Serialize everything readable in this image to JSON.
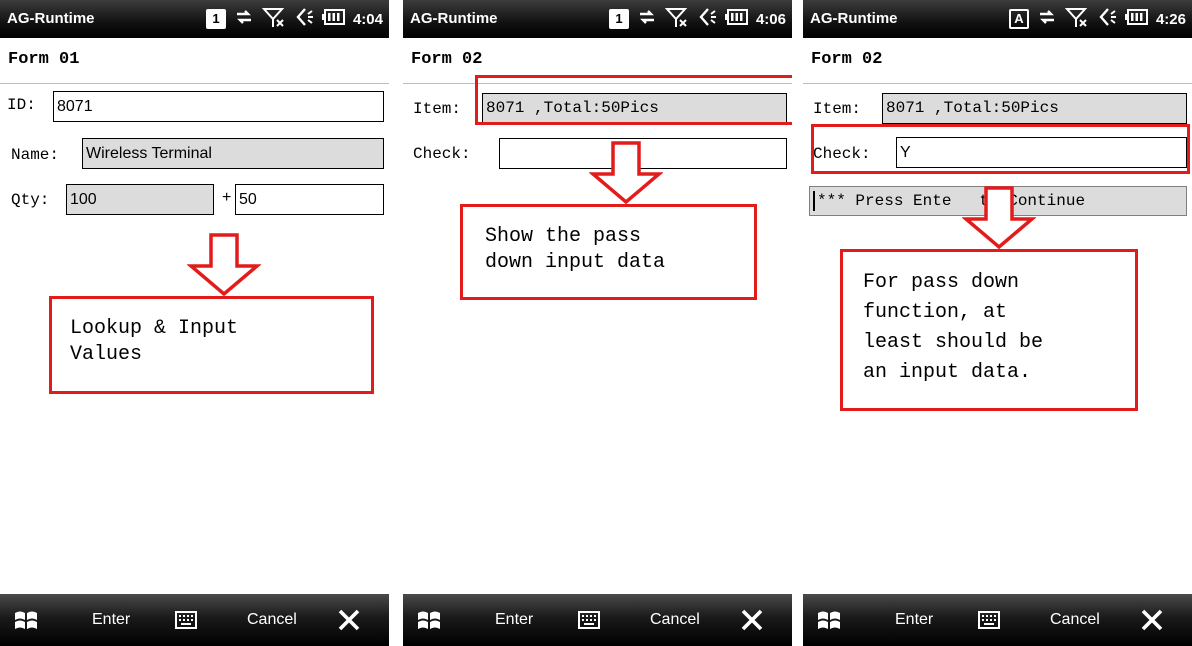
{
  "colors": {
    "callout_red": "#e21b1b",
    "readonly_bg": "#dcdcdc",
    "bar_bg": "#000000"
  },
  "screens": [
    {
      "app_title": "AG-Runtime",
      "input_mode": "1",
      "time": "4:04",
      "form_title": "Form 01",
      "fields": {
        "id": {
          "label": "ID:",
          "value": "8071"
        },
        "name": {
          "label": "Name:",
          "value": "Wireless Terminal"
        },
        "qty": {
          "label": "Qty:",
          "value": "100",
          "plus": "+",
          "add_value": "50"
        }
      },
      "callout": [
        "Lookup & Input",
        "Values"
      ],
      "softkeys": {
        "left": "Enter",
        "right": "Cancel"
      }
    },
    {
      "app_title": "AG-Runtime",
      "input_mode": "1",
      "time": "4:06",
      "form_title": "Form 02",
      "fields": {
        "item": {
          "label": "Item:",
          "value": "8071 ,Total:50Pics"
        },
        "check": {
          "label": "Check:",
          "value": ""
        }
      },
      "callout": [
        "Show the pass",
        "down input data"
      ],
      "softkeys": {
        "left": "Enter",
        "right": "Cancel"
      }
    },
    {
      "app_title": "AG-Runtime",
      "input_mode": "A",
      "time": "4:26",
      "form_title": "Form 02",
      "fields": {
        "item": {
          "label": "Item:",
          "value": "8071 ,Total:50Pics"
        },
        "check": {
          "label": "Check:",
          "value": "Y"
        }
      },
      "banner": "*** Press Ente",
      "banner_end": "to Continue",
      "callout": [
        "For pass down",
        "function, at",
        "least should be",
        "an input data."
      ],
      "softkeys": {
        "left": "Enter",
        "right": "Cancel"
      }
    }
  ]
}
